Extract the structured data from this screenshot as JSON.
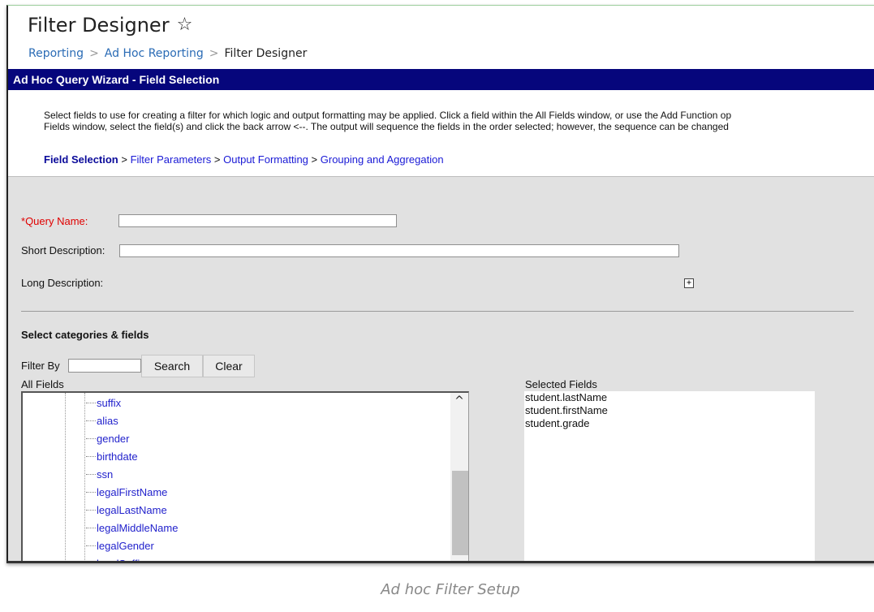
{
  "header": {
    "title": "Filter Designer",
    "breadcrumb": [
      "Reporting",
      "Ad Hoc Reporting",
      "Filter Designer"
    ]
  },
  "wizard": {
    "bar_title": "Ad Hoc Query Wizard - Field Selection",
    "intro_line1": "Select fields to use for creating a filter for which logic and output formatting may be applied. Click a field within the All Fields window, or use the Add Function op",
    "intro_line2": "Fields window, select the field(s) and click the back arrow <--. The output will sequence the fields in the order selected; however, the sequence can be changed",
    "steps": [
      "Field Selection",
      "Filter Parameters",
      "Output Formatting",
      "Grouping and Aggregation"
    ],
    "step_separator": ">"
  },
  "form": {
    "required_marker": "*",
    "query_name_label": "Query Name:",
    "query_name_value": "",
    "short_description_label": "Short Description:",
    "short_description_value": "",
    "long_description_label": "Long Description:",
    "expand_symbol": "+",
    "section_title": "Select categories & fields",
    "filter_by_label": "Filter By",
    "filter_by_value": "",
    "search_label": "Search",
    "clear_label": "Clear",
    "all_fields_label": "All Fields",
    "all_fields": [
      "suffix",
      "alias",
      "gender",
      "birthdate",
      "ssn",
      "legalFirstName",
      "legalLastName",
      "legalMiddleName",
      "legalGender",
      "legalSuffix"
    ],
    "selected_fields_label": "Selected Fields",
    "selected_fields": [
      "student.lastName",
      "student.firstName",
      "student.grade"
    ]
  },
  "caption": "Ad hoc Filter Setup",
  "colors": {
    "wizard_bar": "#06067c",
    "link": "#2222cc",
    "required": "#e00000",
    "form_bg": "#e1e1e1"
  }
}
